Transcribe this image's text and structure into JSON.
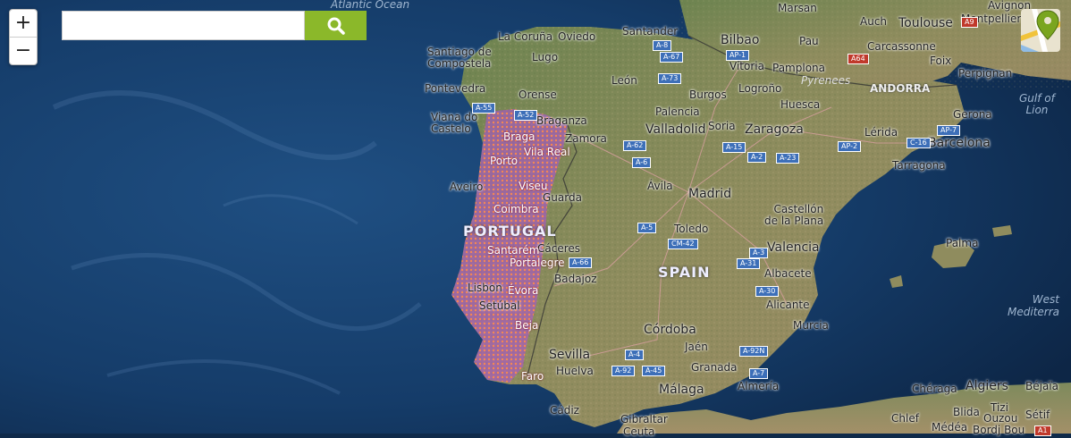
{
  "controls": {
    "zoom_in": "+",
    "zoom_out": "−",
    "search_value": "",
    "search_placeholder": "",
    "search_icon": "magnifier-icon",
    "layer_switcher_icon": "map-marker-icon"
  },
  "colors": {
    "ocean": "#143a66",
    "land": "#7c8c5a",
    "search_button": "#8bb82a",
    "coverage_overlay": "#b04fd8"
  },
  "labels": {
    "atlantic": "Atlantic Ocean",
    "marsan": "Marsan",
    "auch": "Auch",
    "toulouse": "Toulouse",
    "montpellier": "Montpellier",
    "avignon": "Avignon",
    "pau": "Pau",
    "carcassonne": "Carcassonne",
    "foix": "Foix",
    "perpignan": "Perpignan",
    "andorra": "ANDORRA",
    "gulf_lion": "Gulf of\nLion",
    "lacoruna": "La Coruña",
    "oviedo": "Oviedo",
    "santander": "Santander",
    "bilbao": "Bilbao",
    "santiago": "Santiago de\nCompostela",
    "lugo": "Lugo",
    "vitoria": "Vitoria",
    "pamplona": "Pamplona",
    "pyrenees": "Pyrenees",
    "pontevedra": "Pontevedra",
    "orense": "Orense",
    "leon": "León",
    "burgos": "Burgos",
    "logrono": "Logroño",
    "huesca": "Huesca",
    "lerida": "Lérida",
    "gerona": "Gerona",
    "barcelona": "Barcelona",
    "tarragona": "Tarragona",
    "vianadocastelo": "Viana do\nCastelo",
    "braganza": "Braganza",
    "zamora": "Zamora",
    "palencia": "Palencia",
    "valladolid": "Valladolid",
    "soria": "Soria",
    "zaragoza": "Zaragoza",
    "aveiro": "Aveiro",
    "guarda": "Guarda",
    "avila": "Ávila",
    "madrid": "Madrid",
    "castellon": "Castellón\nde la Plana",
    "portugal": "PORTUGAL",
    "caceres": "Cáceres",
    "toledo": "Toledo",
    "valencia": "Valencia",
    "palma": "Palma",
    "spain": "SPAIN",
    "albacete": "Albacete",
    "lisbon": "Lisbon",
    "setubal": "Setúbal",
    "badajoz": "Badajoz",
    "alicante": "Alicante",
    "murcia": "Murcia",
    "cordoba": "Córdoba",
    "jaen": "Jaén",
    "sevilla": "Sevilla",
    "huelva": "Huelva",
    "granada": "Granada",
    "almeria": "Almería",
    "malaga": "Málaga",
    "cadiz": "Cádiz",
    "gibraltar": "Gibraltar",
    "ceuta": "Ceuta",
    "algiers": "Algiers",
    "cheraga": "Chéraga",
    "bejaia": "Béjaïa",
    "blida": "Blida",
    "tizi": "Tizi",
    "ouzou": "Ouzou",
    "setif": "Sétif",
    "chlef": "Chlef",
    "medea": "Médéa",
    "bordjbou": "Bordj Bou",
    "westmed": "West\nMediterra",
    "viseu": "Viseu",
    "coimbra": "Coimbra",
    "porto": "Porto",
    "vilareal": "Vila Real",
    "braga": "Braga",
    "faro": "Faro",
    "evora": "Évora",
    "portalegre": "Portalegre",
    "beja": "Beja",
    "santarem": "Santarém"
  },
  "road_shields": [
    "A-8",
    "A-67",
    "AP-1",
    "A-73",
    "A-55",
    "A-52",
    "A-62",
    "A-6",
    "A-15",
    "A-2",
    "A-23",
    "AP-2",
    "AP-7",
    "C-16",
    "A-5",
    "CM-42",
    "A-66",
    "A-3",
    "A-31",
    "A-30",
    "A-4",
    "A-92N",
    "A-92",
    "A-45",
    "A-7",
    "A9",
    "A64",
    "A1"
  ]
}
